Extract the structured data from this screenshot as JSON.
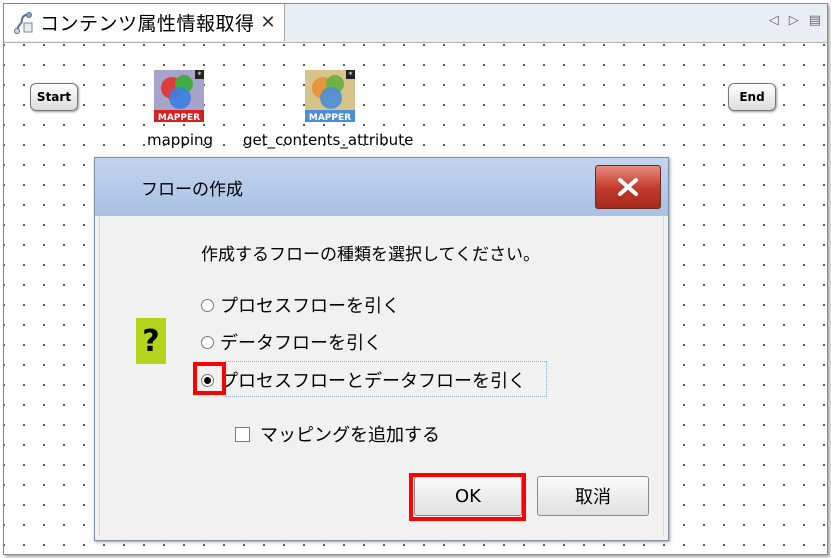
{
  "tab": {
    "title": "コンテンツ属性情報取得",
    "close_glyph": "✕",
    "left_glyph": "◁",
    "right_glyph": "▷",
    "menu_glyph": "▤"
  },
  "canvas": {
    "start_label": "Start",
    "end_label": "End",
    "nodes": [
      {
        "label": "mapping",
        "badge": "MAPPER"
      },
      {
        "label": "get_contents_attribute",
        "badge": "MAPPER"
      }
    ]
  },
  "dialog": {
    "title": "フローの作成",
    "question_glyph": "?",
    "prompt": "作成するフローの種類を選択してください。",
    "options": [
      {
        "label": "プロセスフローを引く",
        "selected": false
      },
      {
        "label": "データフローを引く",
        "selected": false
      },
      {
        "label": "プロセスフローとデータフローを引く",
        "selected": true
      }
    ],
    "checkbox_label": "マッピングを追加する",
    "checkbox_checked": false,
    "ok_label": "OK",
    "cancel_label": "取消"
  },
  "colors": {
    "highlight": "#ff0000",
    "question_bg": "#b4d41b",
    "titlebar": "#b6cbe8",
    "close_button": "#c0392b"
  }
}
